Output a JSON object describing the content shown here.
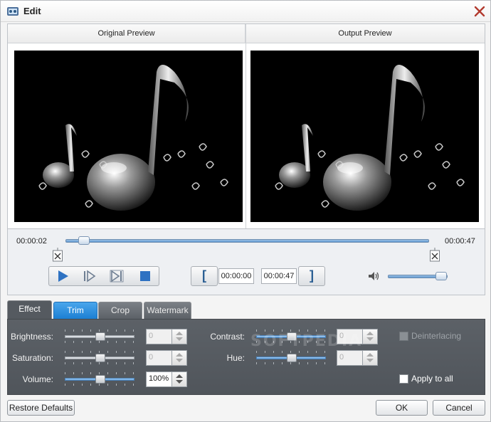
{
  "window": {
    "title": "Edit"
  },
  "preview": {
    "original_label": "Original Preview",
    "output_label": "Output Preview"
  },
  "playback": {
    "current_time": "00:00:02",
    "total_time": "00:00:47",
    "progress": 0.04,
    "trim_start": "00:00:00",
    "trim_end": "00:00:47",
    "volume_level": 0.85,
    "bracket_open": "[",
    "bracket_close": "]"
  },
  "tabs": [
    {
      "label": "Effect",
      "state": "active"
    },
    {
      "label": "Trim",
      "state": "highlighted"
    },
    {
      "label": "Crop",
      "state": "inactive"
    },
    {
      "label": "Watermark",
      "state": "inactive"
    }
  ],
  "effect": {
    "brightness_label": "Brightness:",
    "brightness_value": "0",
    "saturation_label": "Saturation:",
    "saturation_value": "0",
    "volume_label": "Volume:",
    "volume_value": "100%",
    "contrast_label": "Contrast:",
    "contrast_value": "0",
    "hue_label": "Hue:",
    "hue_value": "0",
    "deinterlacing_label": "Deinterlacing",
    "apply_all_label": "Apply to all"
  },
  "watermark_overlay": "SOFTPEDIA",
  "footer": {
    "restore_label": "Restore Defaults",
    "ok_label": "OK",
    "cancel_label": "Cancel"
  },
  "colors": {
    "accent_blue": "#1c7fd3",
    "panel_dark": "#555a60",
    "play_blue": "#2e72c2"
  }
}
